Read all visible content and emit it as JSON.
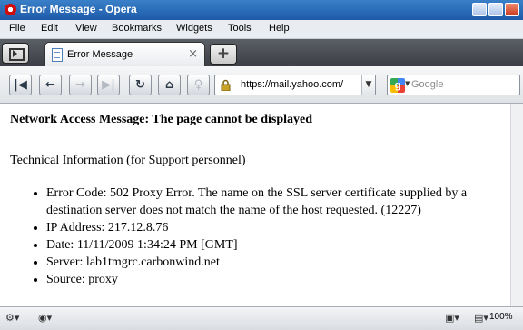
{
  "window": {
    "title": "Error Message - Opera"
  },
  "menu": [
    "File",
    "Edit",
    "View",
    "Bookmarks",
    "Widgets",
    "Tools",
    "Help"
  ],
  "tab": {
    "label": "Error Message",
    "close": "×"
  },
  "newtab_symbol": "+",
  "address": {
    "url": "https://mail.yahoo.com/"
  },
  "search": {
    "placeholder": "Google"
  },
  "page": {
    "heading": "Network Access Message: The page cannot be displayed",
    "tech_info": "Technical Information (for Support personnel)",
    "items": [
      "Error Code: 502 Proxy Error. The name on the SSL server certificate supplied by a destination server does not match the name of the host requested. (12227)",
      "IP Address: 217.12.8.76",
      "Date: 11/11/2009 1:34:24 PM [GMT]",
      "Server: lab1tmgrc.carbonwind.net",
      "Source: proxy"
    ]
  },
  "status": {
    "zoom": "100%"
  },
  "icons": {
    "back_first": "rewind-icon",
    "back": "back-arrow-icon",
    "forward": "forward-arrow-icon",
    "fast_forward": "fast-forward-icon",
    "reload": "reload-icon",
    "home": "home-icon",
    "wand": "wand-icon",
    "lock": "lock-icon"
  },
  "colors": {
    "titlebar": "#1d5aa8",
    "tabbar": "#3b3e44",
    "opera_red": "#d10a0a"
  }
}
